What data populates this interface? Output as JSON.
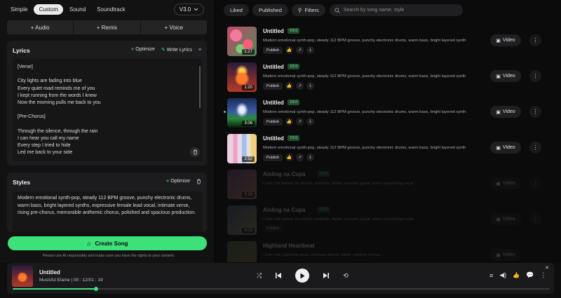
{
  "mode_tabs": [
    "Simple",
    "Custom",
    "Sound",
    "Soundtrack"
  ],
  "active_mode": "Custom",
  "version": "V3.0",
  "add_buttons": [
    "+ Audio",
    "+ Remix",
    "+ Voice"
  ],
  "lyrics": {
    "title": "Lyrics",
    "optimize": "Optimize",
    "write": "Write Lyrics",
    "text": "[Verse]\n\nCity lights are fading into blue\nEvery quiet road reminds me of you\nI kept running from the words I knew\nNow the morning pulls me back to you\n\n[Pre-Chorus]\n\nThrough the silence, through the rain\nI can hear you call my name\nEvery step I tried to hide\nLed me back to your side"
  },
  "styles": {
    "title": "Styles",
    "optimize": "Optimize",
    "text": "Modern emotional synth-pop, steady 112 BPM groove, punchy electronic drums, warm bass, bright layered synths, expressive female lead vocal, intimate verse, rising pre-chorus, memorable anthemic chorus, polished and spacious production."
  },
  "create_label": "Create Song",
  "disclaimer": "Please use AI responsibly and make sure you have the rights to your content.",
  "filters": {
    "liked": "Liked",
    "published": "Published",
    "filters": "Filters",
    "search_placeholder": "Search by song name, style"
  },
  "songs": [
    {
      "title": "Untitled",
      "version": "V3.0",
      "duration": "1:27",
      "desc": "Modern emotional synth-pop, steady 112 BPM groove, punchy electronic drums, warm bass, bright layered synth",
      "publish": "Publish",
      "video": "Video"
    },
    {
      "title": "Untitled",
      "version": "V3.0",
      "duration": "1:20",
      "desc": "Modern emotional synth-pop, steady 112 BPM groove, punchy electronic drums, warm bass, bright layered synth",
      "publish": "Publish",
      "video": "Video"
    },
    {
      "title": "Untitled",
      "version": "V3.0",
      "duration": "3:08",
      "desc": "Modern emotional synth-pop, steady 112 BPM groove, punchy electronic drums, warm bass, bright layered synth",
      "publish": "Publish",
      "video": "Video"
    },
    {
      "title": "Untitled",
      "version": "V3.0",
      "duration": "2:52",
      "desc": "Modern emotional synth-pop, steady 112 BPM groove, punchy electronic drums, warm bass, bright layered synth",
      "publish": "Publish",
      "video": "Video"
    },
    {
      "title": "Aisling na Cupa",
      "version": "V3.0",
      "duration": "3:26",
      "desc": "Celtic folk ballad, tin whistle, bodhran, fiddle, acoustic guitar, warm storytelling vocal",
      "publish": "Publish",
      "video": "Video"
    },
    {
      "title": "Aisling na Cupa",
      "version": "V3.0",
      "duration": "4:02",
      "desc": "Celtic folk ballad, tin whistle, bodhran, fiddle, acoustic guitar, warm storytelling vocal",
      "publish": "Publish",
      "video": "Video"
    },
    {
      "title": "Highland Heartbeat",
      "version": "V3.0",
      "duration": "3:15",
      "desc": "Celtic folk, highland pipes, bodhran drums, fiddle, uplifting chorus",
      "publish": "Publish",
      "video": "Video"
    }
  ],
  "player": {
    "title": "Untitled",
    "artist": "Musicful Elaine",
    "time": "00 : 12/01 : 19",
    "progress": 0.155
  }
}
